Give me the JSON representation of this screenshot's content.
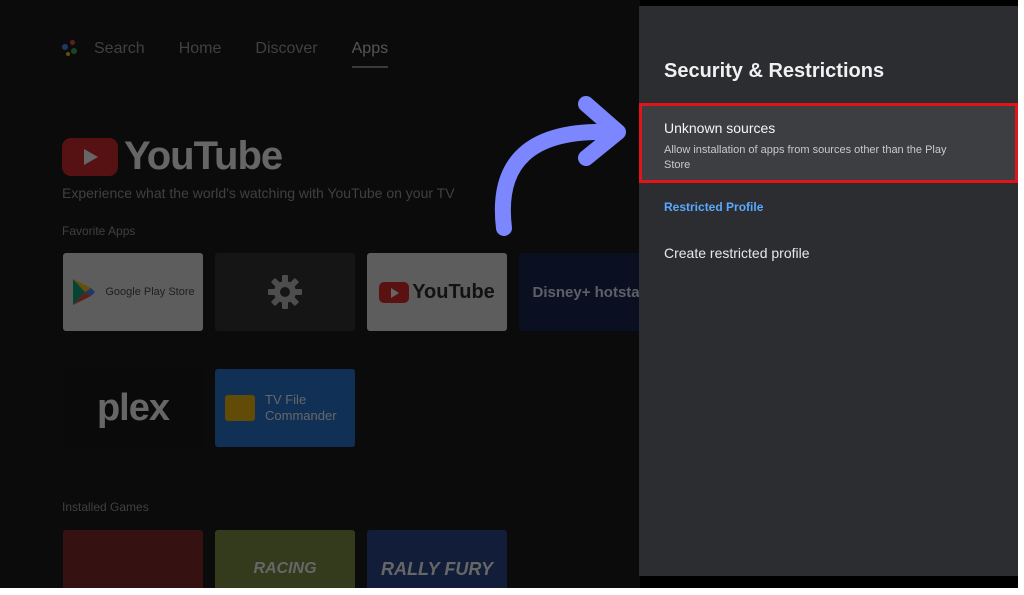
{
  "home": {
    "nav": {
      "search": "Search",
      "home": "Home",
      "discover": "Discover",
      "apps": "Apps"
    },
    "hero": {
      "brand": "YouTube",
      "description": "Experience what the world's watching with YouTube on your TV"
    },
    "favorites_label": "Favorite Apps",
    "apps": [
      {
        "label": "Google Play Store"
      },
      {
        "label": ""
      },
      {
        "label": "YouTube"
      },
      {
        "label": "Disney+ hotstar"
      },
      {
        "label": "plex"
      },
      {
        "label": "TV File Commander"
      }
    ],
    "games_label": "Installed Games",
    "games": [
      {
        "label": ""
      },
      {
        "label": "RACING"
      },
      {
        "label": "RALLY FURY"
      }
    ]
  },
  "panel": {
    "title": "Security & Restrictions",
    "unknown_sources": {
      "title": "Unknown sources",
      "description": "Allow installation of apps from sources other than the Play Store"
    },
    "restricted_profile_header": "Restricted Profile",
    "create_restricted_profile": "Create restricted profile"
  },
  "colors": {
    "panel_bg": "#2b2d30",
    "highlight_border": "#e1131b",
    "section_accent": "#5ba8ff",
    "arrow": "#7b86ff"
  }
}
